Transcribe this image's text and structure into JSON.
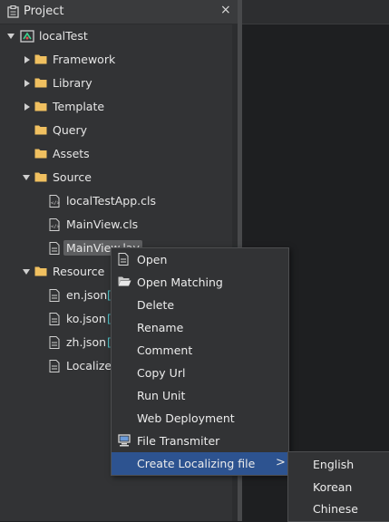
{
  "panel": {
    "title": "Project",
    "close_symbol": "×",
    "icon": "project-icon"
  },
  "tree": {
    "root": {
      "label": "localTest",
      "icon": "project-root-icon",
      "expanded": true
    },
    "items": [
      {
        "label": "Framework",
        "type": "folder",
        "expanded": false
      },
      {
        "label": "Library",
        "type": "folder",
        "expanded": false
      },
      {
        "label": "Template",
        "type": "folder",
        "expanded": false
      },
      {
        "label": "Query",
        "type": "folder"
      },
      {
        "label": "Assets",
        "type": "folder"
      },
      {
        "label": "Source",
        "type": "folder",
        "expanded": true
      },
      {
        "label": "localTestApp.cls",
        "type": "code-file"
      },
      {
        "label": "MainView.cls",
        "type": "code-file"
      },
      {
        "label": "MainView.lay",
        "type": "layout-file",
        "selected": true
      },
      {
        "label": "Resource",
        "type": "folder",
        "expanded": true
      },
      {
        "label": "en.json",
        "type": "file",
        "suffix": "["
      },
      {
        "label": "ko.json",
        "type": "file",
        "suffix": "["
      },
      {
        "label": "zh.json",
        "type": "file",
        "suffix": "["
      },
      {
        "label": "LocalizeL",
        "type": "file"
      }
    ]
  },
  "context_menu": {
    "items": [
      {
        "label": "Open",
        "icon": "file-icon"
      },
      {
        "label": "Open Matching",
        "icon": "folder-open-icon"
      },
      {
        "label": "Delete"
      },
      {
        "label": "Rename"
      },
      {
        "label": "Comment"
      },
      {
        "label": "Copy Url"
      },
      {
        "label": "Run Unit"
      },
      {
        "label": "Web Deployment"
      },
      {
        "label": "File Transmiter",
        "icon": "computer-icon"
      },
      {
        "label": "Create Localizing file",
        "highlighted": true,
        "submenu_symbol": ">"
      }
    ],
    "submenu": [
      "English",
      "Korean",
      "Chinese"
    ]
  },
  "colors": {
    "highlight": "#2d5390",
    "folder": "#f0c060",
    "accent_bracket": "#4fc3c8"
  }
}
